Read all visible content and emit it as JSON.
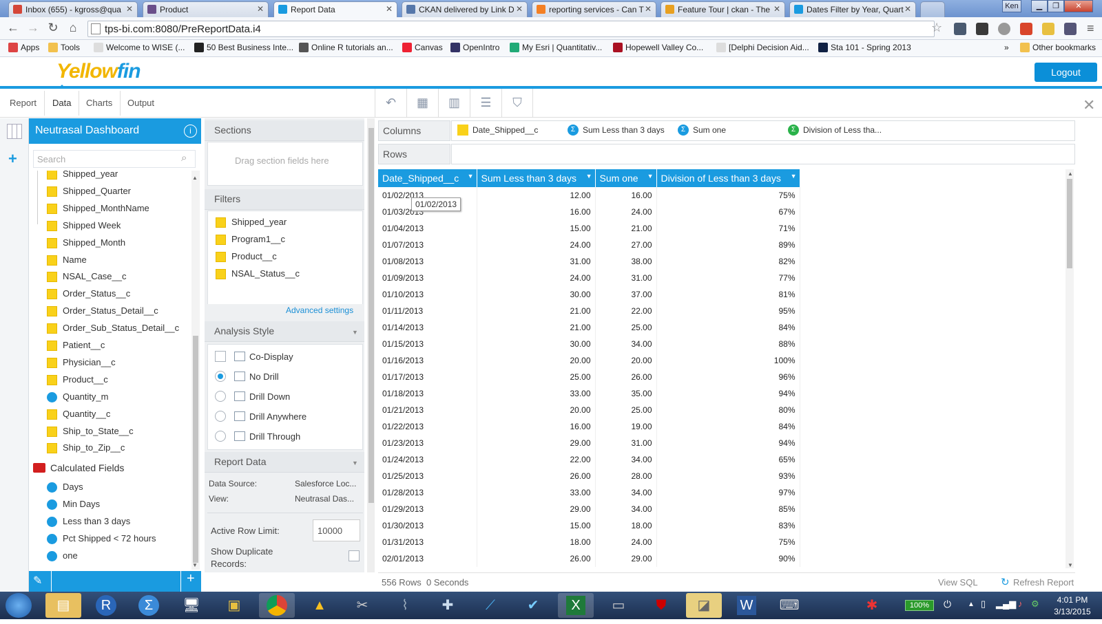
{
  "browser": {
    "tabs": [
      {
        "title": "Inbox (655) - kgross@qua",
        "icon_color": "#d44638"
      },
      {
        "title": "Product",
        "icon_color": "#6a4f8a"
      },
      {
        "title": "Report Data",
        "icon_color": "#1a9be0"
      },
      {
        "title": "CKAN delivered by Link D",
        "icon_color": "#5577aa"
      },
      {
        "title": "reporting services - Can T",
        "icon_color": "#f48024"
      },
      {
        "title": "Feature Tour | ckan - The",
        "icon_color": "#e8a020"
      },
      {
        "title": "Dates Filter by Year, Quart",
        "icon_color": "#1a9be0"
      }
    ],
    "user_badge": "Ken",
    "url": "tps-bi.com:8080/PreReportData.i4",
    "bookmarks": [
      {
        "label": "Apps",
        "color": "#d44"
      },
      {
        "label": "Tools",
        "color": "#f2c14e"
      },
      {
        "label": "Welcome to WISE (...",
        "color": "#ddd"
      },
      {
        "label": "50 Best Business Inte...",
        "color": "#222"
      },
      {
        "label": "Online R tutorials an...",
        "color": "#555"
      },
      {
        "label": "Canvas",
        "color": "#e23"
      },
      {
        "label": "OpenIntro",
        "color": "#336"
      },
      {
        "label": "My Esri | Quantitativ...",
        "color": "#2a7"
      },
      {
        "label": "Hopewell Valley Co...",
        "color": "#a12"
      },
      {
        "label": "[Delphi Decision Aid...",
        "color": "#ddd"
      },
      {
        "label": "Sta 101 - Spring 2013",
        "color": "#124"
      }
    ],
    "bookmarks_overflow": "»",
    "other_bookmarks": "Other bookmarks"
  },
  "app": {
    "logo_left": "Yellow",
    "logo_right": "fin",
    "logout": "Logout",
    "tabs": [
      "Report",
      "Data",
      "Charts",
      "Output"
    ]
  },
  "left": {
    "title": "Neutrasal Dashboard",
    "search_placeholder": "Search",
    "fields": [
      {
        "label": "Shipped_year",
        "kind": "dim"
      },
      {
        "label": "Shipped_Quarter",
        "kind": "dim"
      },
      {
        "label": "Shipped_MonthName",
        "kind": "dim"
      },
      {
        "label": "Shipped Week",
        "kind": "dim"
      },
      {
        "label": "Shipped_Month",
        "kind": "dim"
      },
      {
        "label": "Name",
        "kind": "dim"
      },
      {
        "label": "NSAL_Case__c",
        "kind": "dim"
      },
      {
        "label": "Order_Status__c",
        "kind": "dim"
      },
      {
        "label": "Order_Status_Detail__c",
        "kind": "dim"
      },
      {
        "label": "Order_Sub_Status_Detail__c",
        "kind": "dim"
      },
      {
        "label": "Patient__c",
        "kind": "dim"
      },
      {
        "label": "Physician__c",
        "kind": "dim"
      },
      {
        "label": "Product__c",
        "kind": "dim"
      },
      {
        "label": "Quantity_m",
        "kind": "met"
      },
      {
        "label": "Quantity__c",
        "kind": "dim"
      },
      {
        "label": "Ship_to_State__c",
        "kind": "dim"
      },
      {
        "label": "Ship_to_Zip__c",
        "kind": "dim"
      }
    ],
    "calc_folder": "Calculated Fields",
    "calc_fields": [
      "Days",
      "Min Days",
      "Less than 3 days",
      "Pct Shipped < 72 hours",
      "one"
    ]
  },
  "middle": {
    "sections_title": "Sections",
    "sections_placeholder": "Drag section fields here",
    "filters_title": "Filters",
    "filters": [
      "Shipped_year",
      "Program1__c",
      "Product__c",
      "NSAL_Status__c"
    ],
    "advanced": "Advanced settings",
    "analysis_title": "Analysis Style",
    "codisplay": "Co-Display",
    "styles": [
      {
        "label": "No Drill",
        "selected": true
      },
      {
        "label": "Drill Down",
        "selected": false
      },
      {
        "label": "Drill Anywhere",
        "selected": false
      },
      {
        "label": "Drill Through",
        "selected": false
      }
    ],
    "report_data_title": "Report Data",
    "data_source_label": "Data Source:",
    "data_source_value": "Salesforce Loc...",
    "view_label": "View:",
    "view_value": "Neutrasal Das...",
    "row_limit_label": "Active Row Limit:",
    "row_limit_value": "10000",
    "show_dup_label_1": "Show Duplicate",
    "show_dup_label_2": "Records:"
  },
  "report": {
    "columns_label": "Columns",
    "rows_label": "Rows",
    "column_fields": [
      {
        "label": "Date_Shipped__c",
        "kind": "dim"
      },
      {
        "label": "Sum Less than 3 days",
        "kind": "met"
      },
      {
        "label": "Sum one",
        "kind": "met"
      },
      {
        "label": "Division of Less tha...",
        "kind": "calc"
      }
    ],
    "table_headers": [
      "Date_Shipped__c",
      "Sum Less than 3 days",
      "Sum one",
      "Division of Less than 3 days"
    ],
    "rows": [
      [
        "01/02/2013",
        "12.00",
        "16.00",
        "75%"
      ],
      [
        "01/03/2013",
        "16.00",
        "24.00",
        "67%"
      ],
      [
        "01/04/2013",
        "15.00",
        "21.00",
        "71%"
      ],
      [
        "01/07/2013",
        "24.00",
        "27.00",
        "89%"
      ],
      [
        "01/08/2013",
        "31.00",
        "38.00",
        "82%"
      ],
      [
        "01/09/2013",
        "24.00",
        "31.00",
        "77%"
      ],
      [
        "01/10/2013",
        "30.00",
        "37.00",
        "81%"
      ],
      [
        "01/11/2013",
        "21.00",
        "22.00",
        "95%"
      ],
      [
        "01/14/2013",
        "21.00",
        "25.00",
        "84%"
      ],
      [
        "01/15/2013",
        "30.00",
        "34.00",
        "88%"
      ],
      [
        "01/16/2013",
        "20.00",
        "20.00",
        "100%"
      ],
      [
        "01/17/2013",
        "25.00",
        "26.00",
        "96%"
      ],
      [
        "01/18/2013",
        "33.00",
        "35.00",
        "94%"
      ],
      [
        "01/21/2013",
        "20.00",
        "25.00",
        "80%"
      ],
      [
        "01/22/2013",
        "16.00",
        "19.00",
        "84%"
      ],
      [
        "01/23/2013",
        "29.00",
        "31.00",
        "94%"
      ],
      [
        "01/24/2013",
        "22.00",
        "34.00",
        "65%"
      ],
      [
        "01/25/2013",
        "26.00",
        "28.00",
        "93%"
      ],
      [
        "01/28/2013",
        "33.00",
        "34.00",
        "97%"
      ],
      [
        "01/29/2013",
        "29.00",
        "34.00",
        "85%"
      ],
      [
        "01/30/2013",
        "15.00",
        "18.00",
        "83%"
      ],
      [
        "01/31/2013",
        "18.00",
        "24.00",
        "75%"
      ],
      [
        "02/01/2013",
        "26.00",
        "29.00",
        "90%"
      ]
    ],
    "tooltip": "01/02/2013",
    "row_count": "556 Rows",
    "seconds": "0 Seconds",
    "view_sql": "View SQL",
    "refresh": "Refresh Report"
  },
  "taskbar": {
    "battery": "100%",
    "time": "4:01 PM",
    "date": "3/13/2015"
  }
}
